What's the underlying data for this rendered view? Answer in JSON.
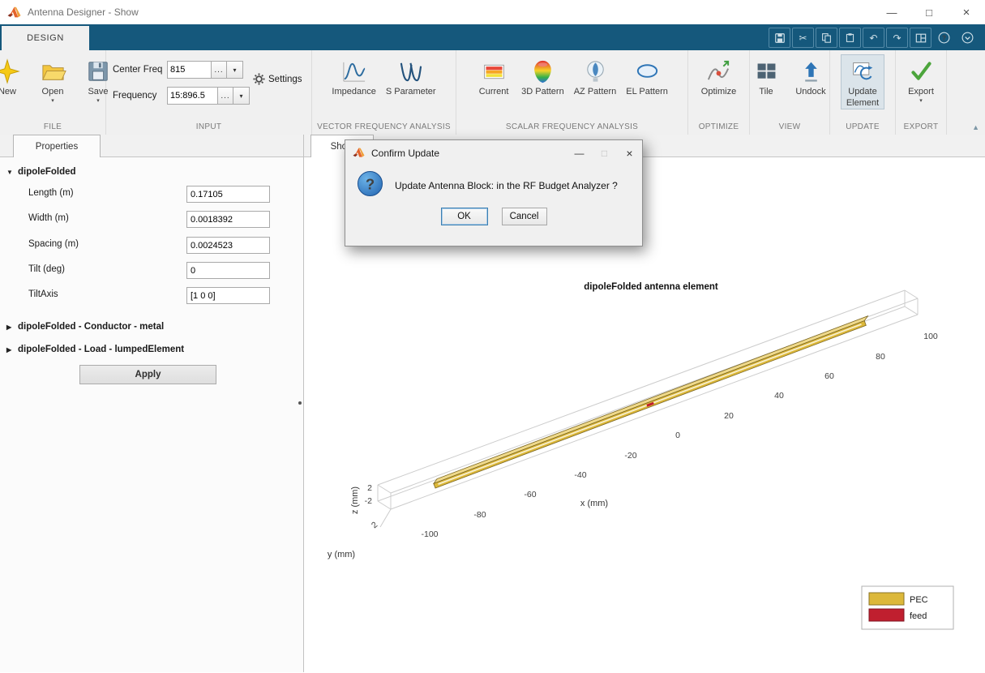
{
  "window": {
    "title": "Antenna Designer - Show"
  },
  "icons": {
    "minimize": "—",
    "maximize": "□",
    "close": "×",
    "dropdown": "▾",
    "more": "...",
    "collapsed": "▶",
    "expanded": "▼",
    "undo": "↶",
    "redo": "↷",
    "cut": "✂",
    "help": "?",
    "collapse_toolbar": "▲"
  },
  "ribbon": {
    "design_tab": "DESIGN"
  },
  "toolbar": {
    "file": {
      "label": "FILE",
      "new": "New",
      "open": "Open",
      "save": "Save"
    },
    "input": {
      "label": "INPUT",
      "center_freq_label": "Center Freq",
      "center_freq_value": "815",
      "frequency_label": "Frequency",
      "frequency_value": "15:896.5",
      "settings": "Settings"
    },
    "vector": {
      "label": "VECTOR FREQUENCY ANALYSIS",
      "impedance": "Impedance",
      "s_parameter": "S Parameter"
    },
    "scalar": {
      "label": "SCALAR FREQUENCY ANALYSIS",
      "current": "Current",
      "pattern3d": "3D Pattern",
      "az": "AZ Pattern",
      "el": "EL Pattern"
    },
    "optimize": {
      "label": "OPTIMIZE",
      "optimize": "Optimize"
    },
    "view": {
      "label": "VIEW",
      "tile": "Tile",
      "undock": "Undock"
    },
    "update": {
      "label": "UPDATE",
      "line1": "Update",
      "line2": "Element"
    },
    "export": {
      "label": "EXPORT",
      "export": "Export"
    }
  },
  "properties": {
    "tab": "Properties",
    "group": "dipoleFolded",
    "fields": [
      {
        "label": "Length (m)",
        "value": "0.17105"
      },
      {
        "label": "Width (m)",
        "value": "0.0018392"
      },
      {
        "label": "Spacing (m)",
        "value": "0.0024523"
      },
      {
        "label": "Tilt (deg)",
        "value": "0"
      },
      {
        "label": "TiltAxis",
        "value": "[1 0 0]"
      }
    ],
    "conductor_group": "dipoleFolded - Conductor - metal",
    "load_group": "dipoleFolded - Load - lumpedElement",
    "apply": "Apply"
  },
  "viewer": {
    "tab": "Show"
  },
  "dialog": {
    "title": "Confirm Update",
    "message": "Update Antenna Block: in the RF Budget Analyzer ?",
    "ok": "OK",
    "cancel": "Cancel"
  },
  "chart": {
    "type": "3d-geometry",
    "title": "dipoleFolded antenna element",
    "xlabel": "x (mm)",
    "ylabel": "y (mm)",
    "zlabel": "z (mm)",
    "x_ticks": [
      "-100",
      "-80",
      "-60",
      "-40",
      "-20",
      "0",
      "20",
      "40",
      "60",
      "80",
      "100"
    ],
    "z_ticks": [
      "2",
      "-2"
    ],
    "y_ticks": [
      "2"
    ],
    "legend": [
      {
        "label": "PEC",
        "color": "#dcb83a"
      },
      {
        "label": "feed",
        "color": "#c01f2f"
      }
    ]
  }
}
